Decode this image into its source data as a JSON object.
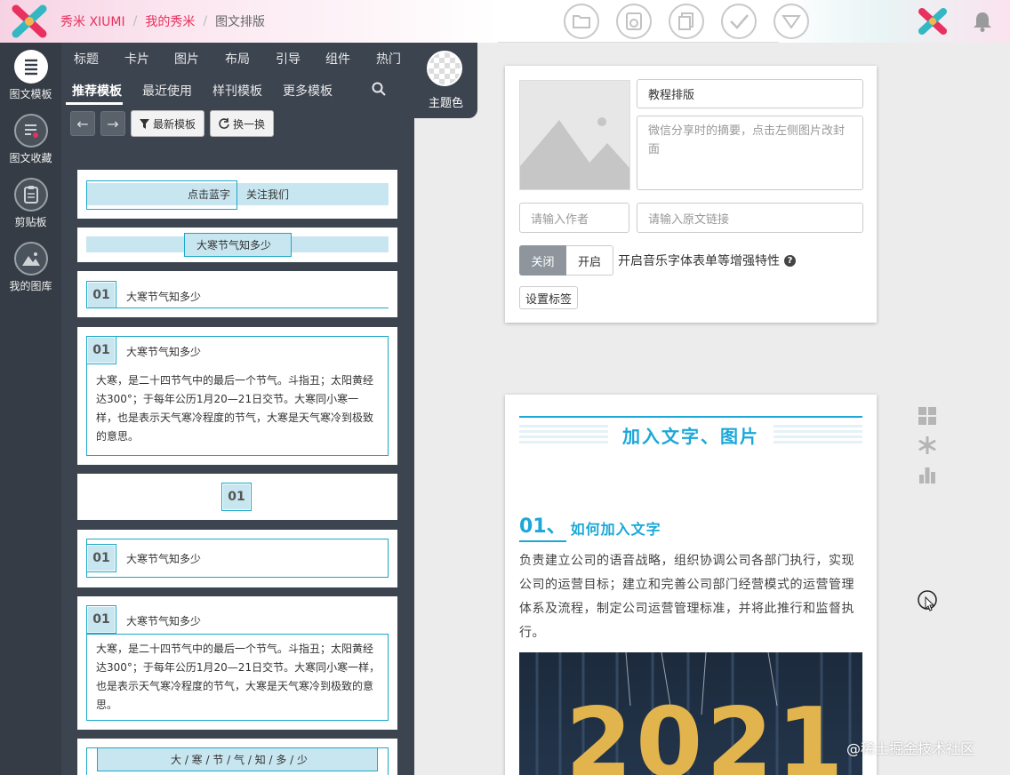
{
  "header": {
    "brand": "秀米 XIUMI",
    "crumb_mine": "我的秀米",
    "crumb_current": "图文排版",
    "toolbar_icons": [
      "folder-icon",
      "preview-icon",
      "copy-icon",
      "check-icon",
      "dropdown-icon"
    ]
  },
  "leftnav": [
    {
      "label": "图文模板",
      "icon": "document-lines-icon",
      "active": true
    },
    {
      "label": "图文收藏",
      "icon": "favorite-doc-icon",
      "active": false
    },
    {
      "label": "剪贴板",
      "icon": "clipboard-icon",
      "active": false
    },
    {
      "label": "我的图库",
      "icon": "gallery-icon",
      "active": false
    }
  ],
  "categories": [
    "标题",
    "卡片",
    "图片",
    "布局",
    "引导",
    "组件",
    "热门"
  ],
  "tabs": [
    "推荐模板",
    "最近使用",
    "样刊模板",
    "更多模板"
  ],
  "theme_label": "主题色",
  "buttons": {
    "latest": "最新模板",
    "shuffle": "换一换"
  },
  "templates": {
    "follow_left": "点击蓝字",
    "follow_right": "关注我们",
    "title": "大寒节气知多少",
    "num": "01",
    "body1": "大寒，是二十四节气中的最后一个节气。斗指丑；太阳黄经达300°；于每年公历1月20—21日交节。大寒同小寒一样，也是表示天气寒冷程度的节气，大寒是天气寒冷到极致的意思。",
    "body2": "大寒，是二十四节气中的最后一个节气。斗指丑；太阳黄经达300°；于每年公历1月20—21日交节。大寒同小寒一样，也是表示天气寒冷程度的节气，大寒是天气寒冷到极致的意思。",
    "spaced_title": "大 / 寒 / 节 / 气 / 知 / 多 / 少"
  },
  "meta": {
    "title_value": "教程排版",
    "summary_placeholder": "微信分享时的摘要，点击左侧图片改封面",
    "author_placeholder": "请输入作者",
    "link_placeholder": "请输入原文链接",
    "music_off": "关闭",
    "music_on": "开启",
    "music_label": "开启音乐字体表单等增强特性",
    "tag_button": "设置标签"
  },
  "article": {
    "header_title": "加入文字、图片",
    "section_num": "01、",
    "section_title": "如何加入文字",
    "paragraph": "负责建立公司的语音战略，组织协调公司各部门执行，实现公司的运营目标；建立和完善公司部门经营模式的运营管理体系及流程，制定公司运营管理标准，并将此推行和监督执行。",
    "photo_text": "2021"
  },
  "watermark": "@稀土掘金技术社区",
  "colors": {
    "brand": "#e8315e",
    "accent": "#1ba8d8",
    "nav_bg": "#353c45",
    "panel_bg": "#3c4450"
  }
}
